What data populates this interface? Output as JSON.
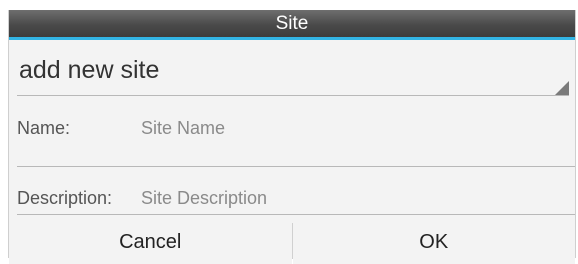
{
  "dialog": {
    "title": "Site",
    "accent_color": "#33b5e5"
  },
  "spinner": {
    "selected_value": "add new site"
  },
  "fields": {
    "name_label": "Name:",
    "name_placeholder": "Site Name",
    "description_label": "Description:",
    "description_placeholder": "Site Description"
  },
  "buttons": {
    "cancel_label": "Cancel",
    "ok_label": "OK"
  }
}
